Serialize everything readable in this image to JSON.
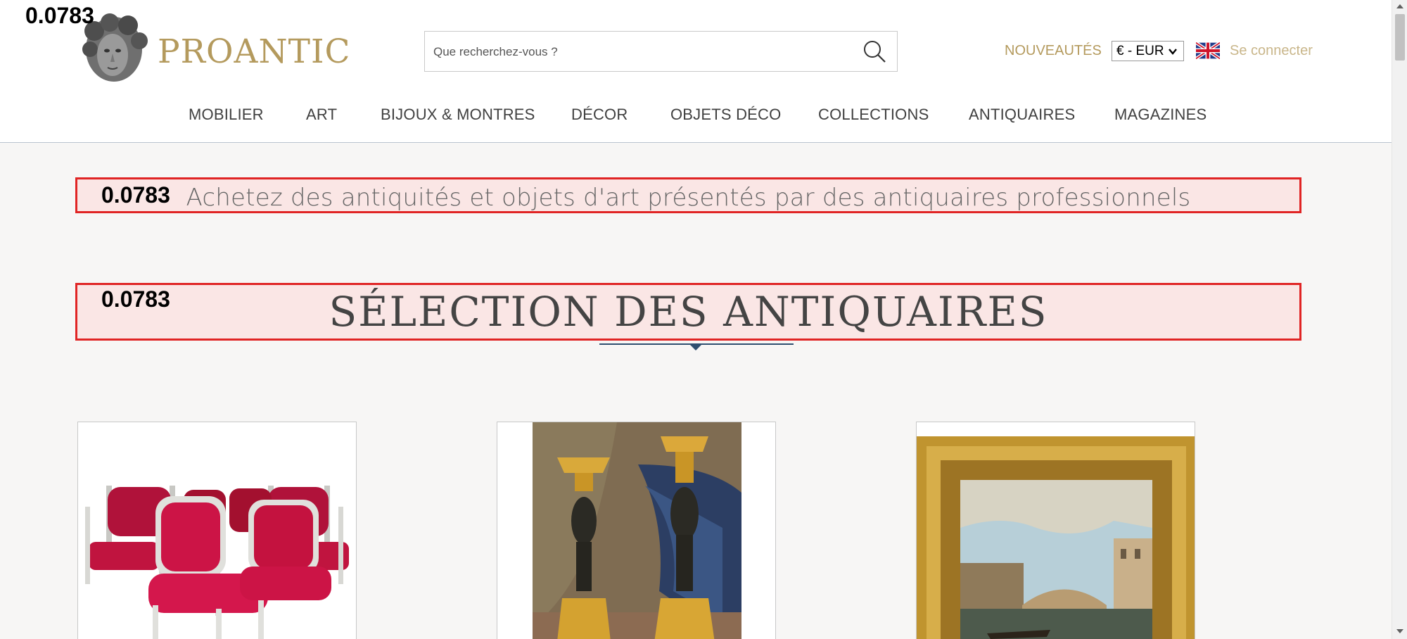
{
  "debug_score": "0.0783",
  "brand": {
    "name": "PROANTIC"
  },
  "search": {
    "placeholder": "Que recherchez-vous ?"
  },
  "header_links": {
    "nouveautes": "NOUVEAUTÉS",
    "currency": "€ - EUR",
    "language_icon": "uk-flag-icon",
    "login": "Se connecter"
  },
  "nav": {
    "items": [
      {
        "label": "MOBILIER"
      },
      {
        "label": "ART"
      },
      {
        "label": "BIJOUX & MONTRES"
      },
      {
        "label": "DÉCOR"
      },
      {
        "label": "OBJETS DÉCO"
      },
      {
        "label": "COLLECTIONS"
      },
      {
        "label": "ANTIQUAIRES"
      },
      {
        "label": "MAGAZINES"
      }
    ]
  },
  "main": {
    "tagline": "Achetez des antiquités et objets d'art présentés par des antiquaires professionnels",
    "section_title": "SÉLECTION DES ANTIQUAIRES"
  },
  "products": [
    {
      "image": "red-velvet-armchairs-image"
    },
    {
      "image": "gilt-bronze-candlesticks-image"
    },
    {
      "image": "venice-painting-gilt-frame-image"
    }
  ],
  "colors": {
    "brand_gold": "#b49a5d",
    "highlight_red": "#e02424",
    "nav_text": "#404040",
    "divider_blue": "#2f4f6f"
  }
}
